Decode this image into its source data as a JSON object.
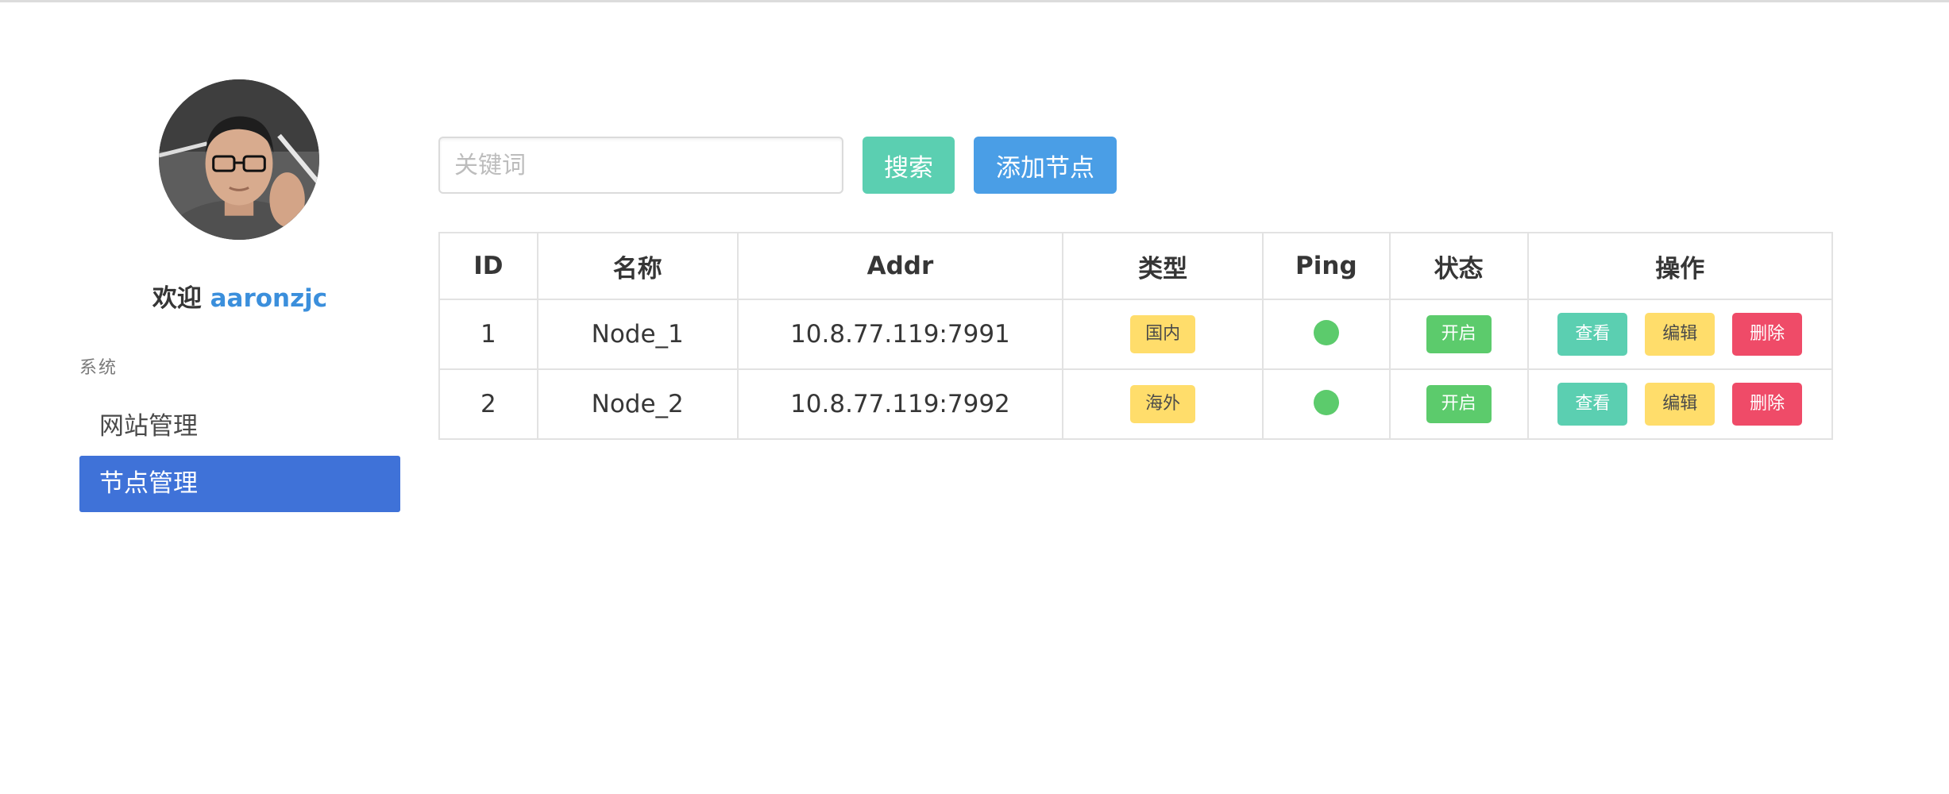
{
  "user": {
    "welcome_prefix": "欢迎",
    "username": "aaronzjc"
  },
  "sidebar": {
    "section_label": "系统",
    "items": [
      {
        "label": "网站管理",
        "active": false
      },
      {
        "label": "节点管理",
        "active": true
      }
    ]
  },
  "toolbar": {
    "search_placeholder": "关键词",
    "search_value": "",
    "search_label": "搜索",
    "add_label": "添加节点"
  },
  "table": {
    "columns": [
      "ID",
      "名称",
      "Addr",
      "类型",
      "Ping",
      "状态",
      "操作"
    ],
    "rows": [
      {
        "id": "1",
        "name": "Node_1",
        "addr": "10.8.77.119:7991",
        "type": "国内",
        "ping": "online",
        "status": "开启",
        "actions": {
          "view": "查看",
          "edit": "编辑",
          "delete": "删除"
        }
      },
      {
        "id": "2",
        "name": "Node_2",
        "addr": "10.8.77.119:7992",
        "type": "海外",
        "ping": "online",
        "status": "开启",
        "actions": {
          "view": "查看",
          "edit": "编辑",
          "delete": "删除"
        }
      }
    ]
  },
  "colors": {
    "primary": "#3f72d8",
    "link": "#3b8fdc",
    "success": "#5ccb6c",
    "warning": "#ffdd6b",
    "danger": "#ef4b68",
    "teal": "#5bcfb1",
    "info": "#4a9ee6"
  }
}
